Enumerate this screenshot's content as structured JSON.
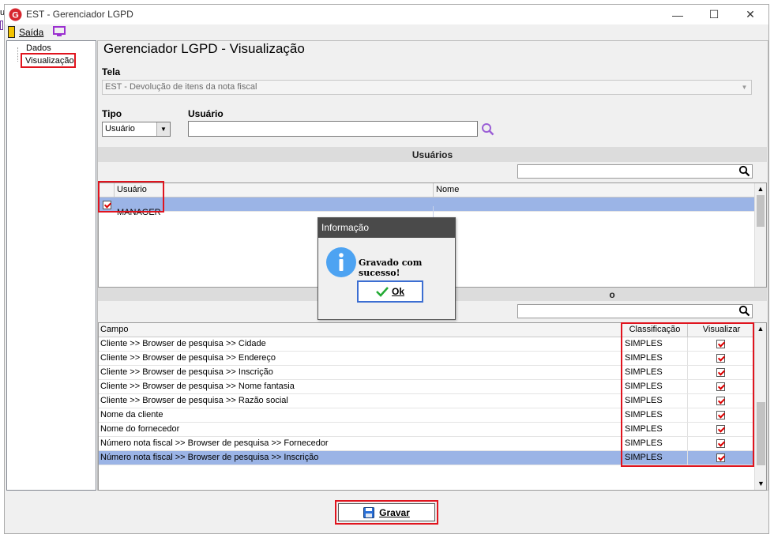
{
  "window": {
    "title": "EST - Gerenciador LGPD",
    "edge_char": "u",
    "minimize": "—",
    "maximize": "☐",
    "close": "✕"
  },
  "menu": {
    "exit_label": "Saída"
  },
  "tree": {
    "items": [
      "Dados",
      "Visualização"
    ]
  },
  "page": {
    "title": "Gerenciador LGPD - Visualização"
  },
  "tela": {
    "label": "Tela",
    "value": "EST - Devolução de itens da nota fiscal"
  },
  "tipo": {
    "label": "Tipo",
    "value": "Usuário"
  },
  "usuario": {
    "label": "Usuário",
    "value": ""
  },
  "usuarios_section": {
    "title": "Usuários"
  },
  "users_grid": {
    "columns": [
      "Usuário",
      "Nome"
    ],
    "rows": [
      {
        "usuario": "MANAGER",
        "nome": "",
        "checked": true
      }
    ]
  },
  "fields_section": {
    "title_partial": "o"
  },
  "fields_grid": {
    "columns": [
      "Campo",
      "Classificação",
      "Visualizar"
    ],
    "rows": [
      {
        "campo": "Cliente >> Browser de pesquisa >> Cidade",
        "classificacao": "SIMPLES",
        "visualizar": true
      },
      {
        "campo": "Cliente >> Browser de pesquisa >> Endereço",
        "classificacao": "SIMPLES",
        "visualizar": true
      },
      {
        "campo": "Cliente >> Browser de pesquisa >> Inscrição",
        "classificacao": "SIMPLES",
        "visualizar": true
      },
      {
        "campo": "Cliente >> Browser de pesquisa >> Nome fantasia",
        "classificacao": "SIMPLES",
        "visualizar": true
      },
      {
        "campo": "Cliente >> Browser de pesquisa >> Razão social",
        "classificacao": "SIMPLES",
        "visualizar": true
      },
      {
        "campo": "Nome da cliente",
        "classificacao": "SIMPLES",
        "visualizar": true
      },
      {
        "campo": "Nome do fornecedor",
        "classificacao": "SIMPLES",
        "visualizar": true
      },
      {
        "campo": "Número nota fiscal >> Browser de pesquisa >> Fornecedor",
        "classificacao": "SIMPLES",
        "visualizar": true
      },
      {
        "campo": "Número nota fiscal >> Browser de pesquisa >> Inscrição",
        "classificacao": "SIMPLES",
        "visualizar": true
      }
    ]
  },
  "dialog": {
    "title": "Informação",
    "message": "Gravado com sucesso!",
    "ok_label": "Ok"
  },
  "footer": {
    "save_label": "Gravar"
  },
  "colors": {
    "selection": "#9bb4e6",
    "highlight": "#e0141e",
    "dialog_title": "#4a4a4a",
    "search_icon": "#9b5fd6"
  }
}
